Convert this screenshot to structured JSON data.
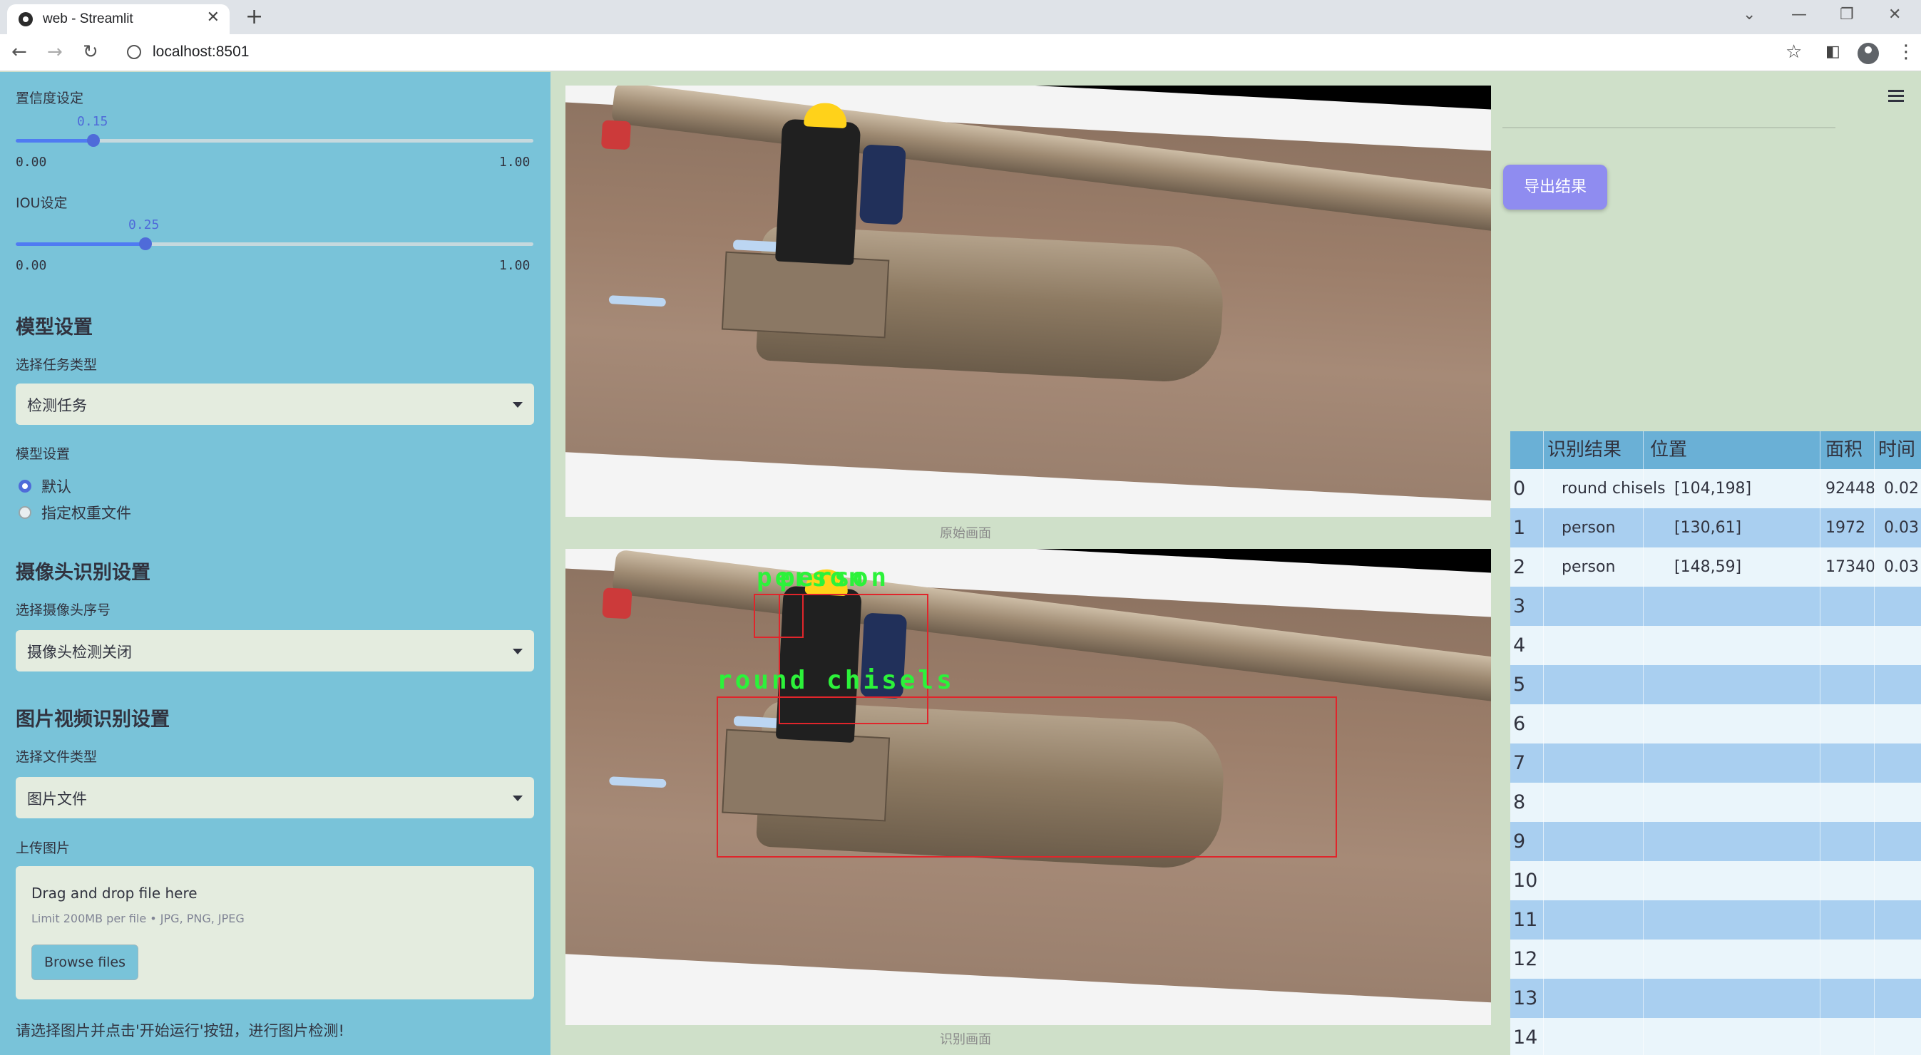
{
  "browser": {
    "tab_title": "web - Streamlit",
    "url": "localhost:8501",
    "close_glyph": "✕",
    "new_tab_glyph": "+",
    "back_glyph": "←",
    "forward_glyph": "→",
    "reload_glyph": "↻",
    "star_glyph": "☆",
    "menu_glyph": "⋮"
  },
  "sidebar": {
    "confidence": {
      "label": "置信度设定",
      "value": "0.15",
      "value_fraction": 0.15,
      "min": "0.00",
      "max": "1.00"
    },
    "iou": {
      "label": "IOU设定",
      "value": "0.25",
      "value_fraction": 0.25,
      "min": "0.00",
      "max": "1.00"
    },
    "model_section": {
      "heading": "模型设置",
      "task_label": "选择任务类型",
      "task_value": "检测任务",
      "model_label": "模型设置",
      "options": [
        "默认",
        "指定权重文件"
      ],
      "selected_option": "默认"
    },
    "camera_section": {
      "heading": "摄像头识别设置",
      "camera_label": "选择摄像头序号",
      "camera_value": "摄像头检测关闭"
    },
    "media_section": {
      "heading": "图片视频识别设置",
      "file_type_label": "选择文件类型",
      "file_type_value": "图片文件",
      "upload_label": "上传图片",
      "drop_text": "Drag and drop file here",
      "limit_text": "Limit 200MB per file • JPG, PNG, JPEG",
      "browse_label": "Browse files"
    },
    "hint": "请选择图片并点击'开始运行'按钮，进行图片检测!"
  },
  "main": {
    "original_caption": "原始画面",
    "result_caption": "识别画面",
    "detections": [
      {
        "label": "person"
      },
      {
        "label": "person"
      },
      {
        "label": "round chisels"
      }
    ]
  },
  "right": {
    "export_label": "导出结果",
    "table": {
      "headers": [
        "识别结果",
        "位置",
        "面积",
        "时间"
      ],
      "rows": [
        {
          "idx": "0",
          "result": "round chisels",
          "position": "[104,198]",
          "area": "92448",
          "time": "0.02"
        },
        {
          "idx": "1",
          "result": "person",
          "position": "[130,61]",
          "area": "1972",
          "time": "0.03"
        },
        {
          "idx": "2",
          "result": "person",
          "position": "[148,59]",
          "area": "17340",
          "time": "0.03"
        },
        {
          "idx": "3",
          "result": "",
          "position": "",
          "area": "",
          "time": ""
        },
        {
          "idx": "4",
          "result": "",
          "position": "",
          "area": "",
          "time": ""
        },
        {
          "idx": "5",
          "result": "",
          "position": "",
          "area": "",
          "time": ""
        },
        {
          "idx": "6",
          "result": "",
          "position": "",
          "area": "",
          "time": ""
        },
        {
          "idx": "7",
          "result": "",
          "position": "",
          "area": "",
          "time": ""
        },
        {
          "idx": "8",
          "result": "",
          "position": "",
          "area": "",
          "time": ""
        },
        {
          "idx": "9",
          "result": "",
          "position": "",
          "area": "",
          "time": ""
        },
        {
          "idx": "10",
          "result": "",
          "position": "",
          "area": "",
          "time": ""
        },
        {
          "idx": "11",
          "result": "",
          "position": "",
          "area": "",
          "time": ""
        },
        {
          "idx": "12",
          "result": "",
          "position": "",
          "area": "",
          "time": ""
        },
        {
          "idx": "13",
          "result": "",
          "position": "",
          "area": "",
          "time": ""
        },
        {
          "idx": "14",
          "result": "",
          "position": "",
          "area": "",
          "time": ""
        }
      ]
    }
  },
  "colors": {
    "sidebar_bg": "#79c3d9",
    "main_bg": "#cfe0c9",
    "accent": "#4f6bd9",
    "export_button": "#8f8cf0",
    "box_color": "#e0252b",
    "label_color": "#2cf23a",
    "table_header": "#6ab0d6"
  }
}
